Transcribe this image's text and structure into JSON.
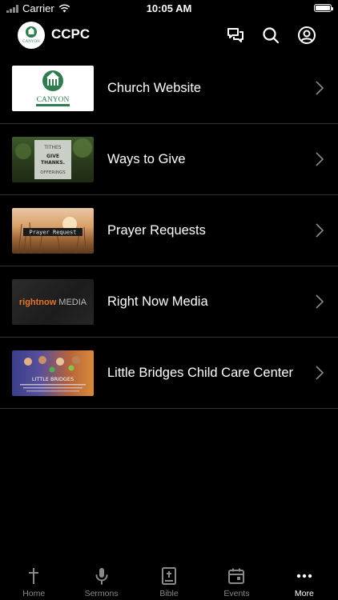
{
  "status_bar": {
    "carrier": "Carrier",
    "time": "10:05 AM"
  },
  "header": {
    "title": "CCPC",
    "logo_text": "CANYON",
    "icons": [
      "chat-icon",
      "search-icon",
      "profile-icon"
    ]
  },
  "items": [
    {
      "label": "Church Website",
      "thumb_text": "CANYON"
    },
    {
      "label": "Ways to Give",
      "thumb_text": [
        "TITHES",
        "GIVE",
        "THANKS.",
        "OFFERINGS"
      ]
    },
    {
      "label": "Prayer Requests",
      "thumb_text": "Prayer Request"
    },
    {
      "label": "Right Now Media",
      "thumb_text": {
        "part1": "rightnow",
        "part2": "MEDIA"
      }
    },
    {
      "label": "Little Bridges Child Care Center",
      "thumb_text": "LITTLE BRIDGES"
    }
  ],
  "tabs": [
    {
      "label": "Home",
      "icon": "cross-icon",
      "active": false
    },
    {
      "label": "Sermons",
      "icon": "microphone-icon",
      "active": false
    },
    {
      "label": "Bible",
      "icon": "bible-icon",
      "active": false
    },
    {
      "label": "Events",
      "icon": "calendar-icon",
      "active": false
    },
    {
      "label": "More",
      "icon": "more-icon",
      "active": true
    }
  ],
  "colors": {
    "background": "#000000",
    "divider": "#333333",
    "inactive_tab": "#8a8a8a",
    "canyon_green": "#2e7d4f",
    "rightnow_orange": "#e8742a"
  }
}
